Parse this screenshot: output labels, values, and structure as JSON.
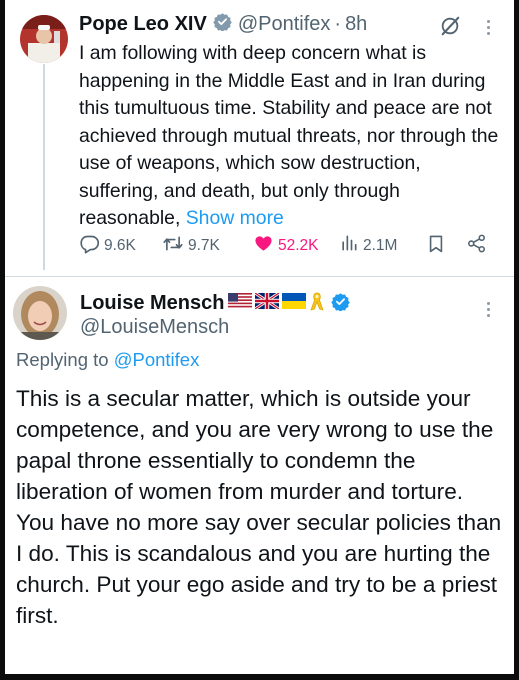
{
  "tweet1": {
    "author_name": "Pope Leo XIV",
    "author_handle": "@Pontifex",
    "separator": "·",
    "time": "8h",
    "body": "I am following with deep concern what is happening in the Middle East and in Iran during this tumultuous time. Stability and peace are not achieved through mutual threats, nor through the use of weapons, which sow destruction, suffering, and death, but only through reasonable, ",
    "show_more": "Show more",
    "stats": {
      "replies": "9.6K",
      "reposts": "9.7K",
      "likes": "52.2K",
      "views": "2.1M"
    },
    "icons": [
      "verified-badge-icon",
      "grok-icon",
      "more-icon",
      "reply-icon",
      "repost-icon",
      "like-icon",
      "views-icon",
      "bookmark-icon",
      "share-icon"
    ],
    "like_color": "#f91880"
  },
  "tweet2": {
    "author_name": "Louise Mensch",
    "author_handle": "@LouiseMensch",
    "replying_prefix": "Replying to ",
    "replying_mention": "@Pontifex",
    "emojis": [
      "us-flag",
      "uk-flag",
      "ukraine-flag",
      "yellow-ribbon"
    ],
    "body": "This is a secular matter, which is outside your competence, and you are very wrong to use the papal throne essentially to condemn the liberation of women from murder and torture. You have no more say over secular policies than I do. This is scandalous and you are hurting the church. Put your ego aside and try to be a priest first."
  },
  "colors": {
    "link": "#1d9bf0",
    "muted": "#536471",
    "verified": "#1d9bf0"
  }
}
